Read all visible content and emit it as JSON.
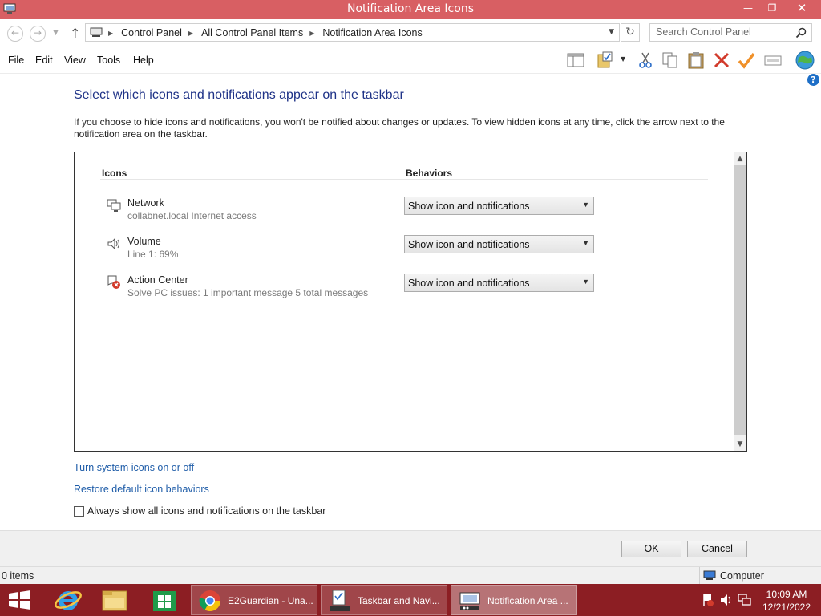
{
  "window": {
    "title": "Notification Area Icons",
    "controls": {
      "minimize": "—",
      "maximize": "❐",
      "close": "✕"
    }
  },
  "addressbar": {
    "breadcrumbs": [
      "Control Panel",
      "All Control Panel Items",
      "Notification Area Icons"
    ],
    "search_placeholder": "Search Control Panel"
  },
  "menubar": {
    "items": [
      "File",
      "Edit",
      "View",
      "Tools",
      "Help"
    ]
  },
  "toolbar": {
    "icons": [
      "preview-pane-icon",
      "folder-check-icon",
      "cut-icon",
      "copy-icon",
      "paste-icon",
      "delete-icon",
      "checkmark-icon",
      "properties-icon",
      "globe-icon",
      "help-icon"
    ]
  },
  "content": {
    "heading": "Select which icons and notifications appear on the taskbar",
    "description": "If you choose to hide icons and notifications, you won't be notified about changes or updates. To view hidden icons at any time, click the arrow next to the notification area on the taskbar.",
    "columns": {
      "icons": "Icons",
      "behaviors": "Behaviors"
    },
    "rows": [
      {
        "name": "Network",
        "sub": "collabnet.local Internet access",
        "behavior": "Show icon and notifications",
        "icon": "network-icon"
      },
      {
        "name": "Volume",
        "sub": "Line 1: 69%",
        "behavior": "Show icon and notifications",
        "icon": "volume-icon"
      },
      {
        "name": "Action Center",
        "sub": "Solve PC issues: 1 important message  5 total messages",
        "behavior": "Show icon and notifications",
        "icon": "action-center-icon"
      }
    ],
    "links": {
      "system_icons": "Turn system icons on or off",
      "restore": "Restore default icon behaviors"
    },
    "always_show_label": "Always show all icons and notifications on the taskbar",
    "always_show_checked": false
  },
  "buttons": {
    "ok": "OK",
    "cancel": "Cancel"
  },
  "statusbar": {
    "count": "0 items",
    "zone": "Computer"
  },
  "taskbar": {
    "tasks": [
      {
        "label": "E2Guardian - Una...",
        "icon": "chrome-icon"
      },
      {
        "label": "Taskbar and Navi...",
        "icon": "taskbar-properties-icon"
      },
      {
        "label": "Notification Area ...",
        "icon": "notification-area-icon"
      }
    ],
    "clock": {
      "time": "10:09 AM",
      "date": "12/21/2022"
    }
  },
  "colors": {
    "titlebar": "#d85f63",
    "taskbar": "#8c1e23",
    "heading": "#1e3287",
    "link": "#1e5ca8"
  }
}
